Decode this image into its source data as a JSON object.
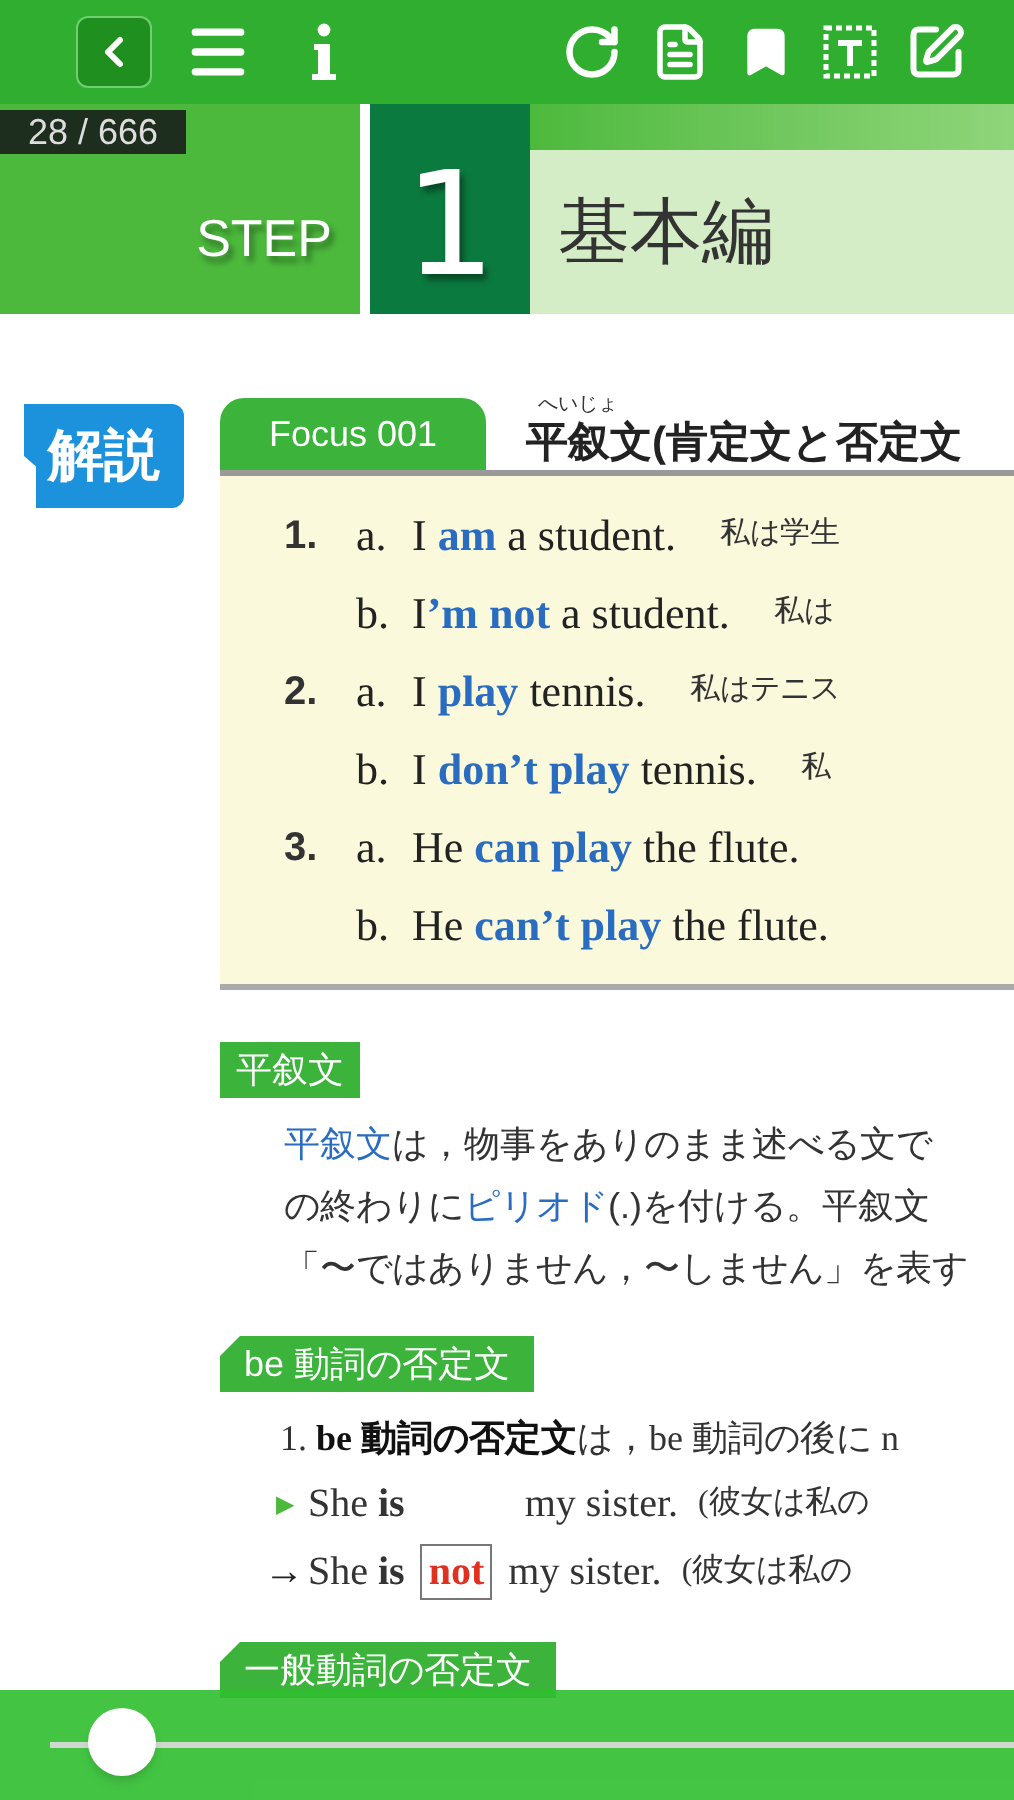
{
  "toolbar": {
    "page_counter": "28 / 666"
  },
  "step": {
    "label": "STEP",
    "number": "1",
    "title": "基本編"
  },
  "badge": "解説",
  "focus": {
    "tag": "Focus 001",
    "ruby": "へいじょ",
    "title": "平叙文(肯定文と否定文",
    "examples": [
      {
        "number": "1.",
        "letter": "a.",
        "text": "I **am** a student.",
        "translation": "私は学生"
      },
      {
        "letter": "b.",
        "text": "I**’m not** a student.",
        "translation": "私は"
      },
      {
        "number": "2.",
        "letter": "a.",
        "text": "I **play** tennis.",
        "translation": "私はテニス"
      },
      {
        "letter": "b.",
        "text": "I **don’t play** tennis.",
        "translation": "私"
      },
      {
        "number": "3.",
        "letter": "a.",
        "text": "He **can play** the flute."
      },
      {
        "letter": "b.",
        "text": "He **can’t play** the flute."
      }
    ]
  },
  "sections": [
    {
      "kind": "plain",
      "heading": "平叙文",
      "lines": [
        "**平叙文**は，物事をありのまま述べる文で",
        "の終わりに**ピリオド**(.)を付ける。平叙文",
        "「〜ではありません，〜しません」を表す"
      ]
    },
    {
      "kind": "tab",
      "heading": "be 動詞の否定文",
      "lines": [
        "1. **be 動詞の否定文**は，be 動詞の後に n"
      ],
      "examples": [
        {
          "marker": "▶",
          "before": "She **is**",
          "after": "my sister.",
          "translation": "(彼女は私の"
        },
        {
          "marker": "→",
          "before": "She **is**",
          "inserted": "not",
          "after": "my sister.",
          "translation": "(彼女は私の"
        }
      ]
    },
    {
      "kind": "tab",
      "heading": "一般動詞の否定文"
    }
  ],
  "slider": {
    "level": 0.04
  }
}
